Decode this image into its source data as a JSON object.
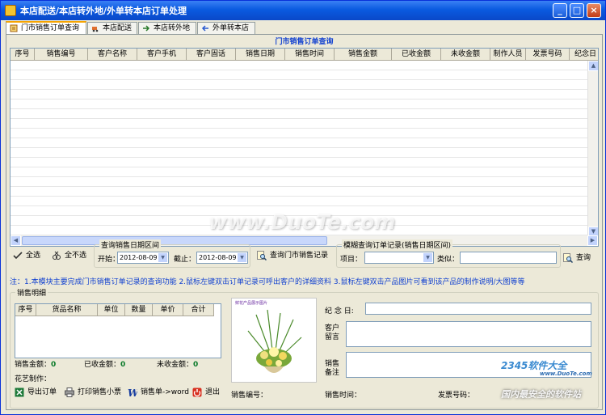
{
  "window": {
    "title": "本店配送/本店转外地/外单转本店订单处理",
    "min": "_",
    "max": "□",
    "close": "×"
  },
  "tabs": [
    {
      "label": "门市销售订单查询"
    },
    {
      "label": "本店配送"
    },
    {
      "label": "本店转外地"
    },
    {
      "label": "外单转本店"
    }
  ],
  "grid": {
    "title": "门市销售订单查询",
    "columns": [
      "序号",
      "销售编号",
      "客户名称",
      "客户手机",
      "客户固话",
      "销售日期",
      "销售时间",
      "销售金额",
      "已收金额",
      "未收金额",
      "制作人员",
      "发票号码",
      "纪念日"
    ]
  },
  "selection": {
    "select_all": "全选",
    "select_none": "全不选"
  },
  "date_query": {
    "legend": "查询销售日期区间",
    "start_label": "开始：",
    "start_value": "2012-08-09",
    "end_label": "截止：",
    "end_value": "2012-08-09",
    "button": "查询门市销售记录"
  },
  "fuzzy_query": {
    "legend": "模糊查询订单记录(销售日期区间)",
    "item_label": "项目：",
    "item_value": "",
    "like_label": "类似：",
    "like_value": "",
    "button": "查询"
  },
  "note": "注：1.本模块主要完成门市销售订单记录的查询功能  2.鼠标左键双击订单记录可呼出客户的详细资料 3.鼠标左键双击产品图片可看到该产品的制作说明/大图等等",
  "details": {
    "legend": "销售明细",
    "columns": [
      "序号",
      "货品名称",
      "单位",
      "数量",
      "单价",
      "合计"
    ],
    "sales_amount_label": "销售金额：",
    "sales_amount": "0",
    "received_label": "已收金额：",
    "received": "0",
    "unreceived_label": "未收金额：",
    "unreceived": "0",
    "florist_label": "花艺制作：",
    "image_caption": "鲜花产品展示图片",
    "anniversary_label": "纪 念 日:",
    "message_label": "客户\n留言",
    "remark_label": "销售\n备注",
    "sales_no_label": "销售编号：",
    "sales_time_label": "销售时间：",
    "invoice_label": "发票号码："
  },
  "actions": [
    {
      "label": "导出订单",
      "icon": "excel-icon"
    },
    {
      "label": "打印销售小票",
      "icon": "printer-icon"
    },
    {
      "label": "销售单->word",
      "icon": "word-icon"
    },
    {
      "label": "退出",
      "icon": "exit-icon"
    }
  ],
  "watermarks": {
    "site": "www.DuoTe.com",
    "brand": "2345软件大全",
    "brand_url": "www.DuoTe.com",
    "slogan": "国内最安全的软件站"
  },
  "colors": {
    "title_bar": "#0a5ae0",
    "accent_blue": "#1040d0",
    "amount_green": "#0a7a2a",
    "tab_highlight": "#f6a400"
  }
}
